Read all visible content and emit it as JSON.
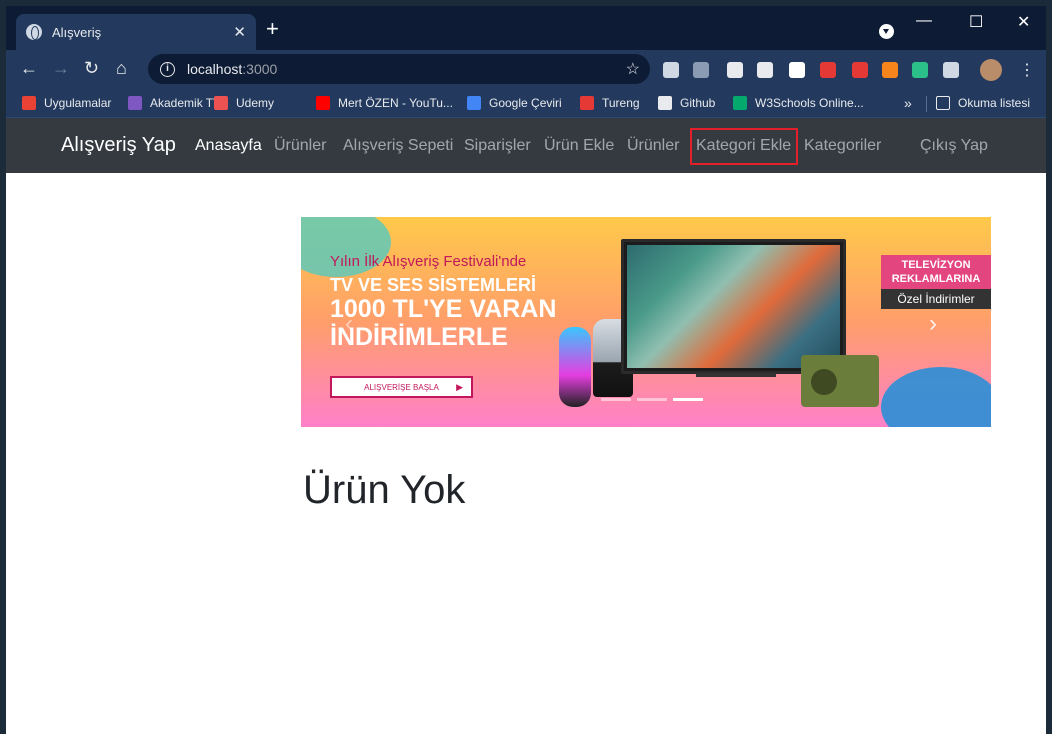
{
  "browser": {
    "tab_title": "Alışveriş",
    "close_glyph": "✕",
    "newtab_glyph": "+",
    "window_controls": {
      "minimize": "—",
      "maximize": "☐",
      "close": "✕"
    },
    "nav": {
      "back": "←",
      "forward": "→",
      "reload": "↻",
      "home": "⌂"
    },
    "url_host": "localhost",
    "url_port": ":3000",
    "star_glyph": "☆",
    "kebab_glyph": "⋮",
    "extensions": [
      {
        "icon": "formula-icon",
        "color": "#cfd8e3"
      },
      {
        "icon": "move-icon",
        "color": "#8a9bb3"
      },
      {
        "icon": "camera-icon",
        "color": "#e8eaed"
      },
      {
        "icon": "gear-icon",
        "color": "#e8eaed"
      },
      {
        "icon": "pen-icon",
        "color": "#ffffff"
      },
      {
        "icon": "download-icon",
        "color": "#e53935"
      },
      {
        "icon": "block-icon",
        "color": "#e53935"
      },
      {
        "icon": "fox-icon",
        "color": "#f6851b"
      },
      {
        "icon": "code-icon",
        "color": "#2bbf8a"
      },
      {
        "icon": "puzzle-icon",
        "color": "#cfd8e3"
      }
    ]
  },
  "bookmarks": {
    "items": [
      {
        "label": "Uygulamalar",
        "icon": "apps-grid-icon",
        "color": "#ea4335"
      },
      {
        "label": "Akademik TV",
        "icon": "play-icon",
        "color": "#7e57c2"
      },
      {
        "label": "Udemy",
        "icon": "udemy-icon",
        "color": "#ec5252"
      },
      {
        "label": "Mert ÖZEN - YouTu...",
        "icon": "youtube-icon",
        "color": "#ff0000"
      },
      {
        "label": "Google Çeviri",
        "icon": "translate-icon",
        "color": "#4285f4"
      },
      {
        "label": "Tureng",
        "icon": "tureng-icon",
        "color": "#e53935"
      },
      {
        "label": "Github",
        "icon": "github-icon",
        "color": "#e8eaed"
      },
      {
        "label": "W3Schools Online...",
        "icon": "w3schools-icon",
        "color": "#04aa6d"
      }
    ],
    "more": "»",
    "reading_list": "Okuma listesi"
  },
  "navbar": {
    "brand": "Alışveriş Yap",
    "links": [
      {
        "label": "Anasayfa",
        "active": true
      },
      {
        "label": "Ürünler"
      },
      {
        "label": "Alışveriş Sepeti"
      },
      {
        "label": "Siparişler"
      },
      {
        "label": "Ürün Ekle"
      },
      {
        "label": "Ürünler"
      },
      {
        "label": "Kategori Ekle",
        "highlighted": true
      },
      {
        "label": "Kategoriler"
      },
      {
        "label": "Çıkış Yap"
      }
    ],
    "highlight_color": "#e3202a"
  },
  "carousel": {
    "subtitle": "Yılın İlk Alışveriş Festivali'nde",
    "line1": "TV VE SES SİSTEMLERİ",
    "line2": "1000 TL'YE VARAN",
    "line3": "İNDİRİMLERLE",
    "cta": "ALIŞVERİŞE BAŞLA",
    "cta_arrow": "▶",
    "tag_line1": "TELEVİZYON",
    "tag_line2": "REKLAMLARINA",
    "tag_line3": "Özel İndirimler",
    "prev": "‹",
    "next": "›",
    "slides": 3,
    "active_slide": 3
  },
  "main": {
    "empty_message": "Ürün Yok"
  }
}
